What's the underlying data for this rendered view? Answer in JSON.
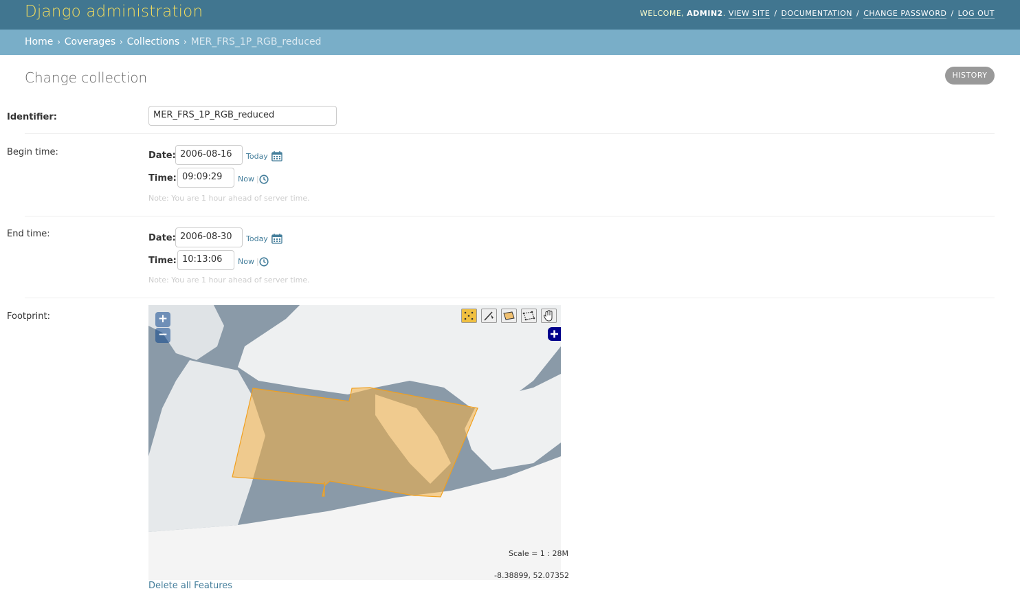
{
  "header": {
    "branding": "Django administration",
    "welcome": "WELCOME,",
    "username": "ADMIN2",
    "view_site": "VIEW SITE",
    "documentation": "DOCUMENTATION",
    "change_password": "CHANGE PASSWORD",
    "logout": "LOG OUT"
  },
  "breadcrumbs": {
    "home": "Home",
    "coverages": "Coverages",
    "collections": "Collections",
    "current": "MER_FRS_1P_RGB_reduced"
  },
  "page": {
    "title": "Change collection",
    "history_button": "HISTORY"
  },
  "form": {
    "identifier": {
      "label": "Identifier:",
      "value": "MER_FRS_1P_RGB_reduced"
    },
    "begin_time": {
      "label": "Begin time:",
      "date_label": "Date:",
      "date_value": "2006-08-16",
      "today": "Today",
      "time_label": "Time:",
      "time_value": "09:09:29",
      "now": "Now",
      "note": "Note: You are 1 hour ahead of server time."
    },
    "end_time": {
      "label": "End time:",
      "date_label": "Date:",
      "date_value": "2006-08-30",
      "today": "Today",
      "time_label": "Time:",
      "time_value": "10:13:06",
      "now": "Now",
      "note": "Note: You are 1 hour ahead of server time."
    },
    "footprint": {
      "label": "Footprint:",
      "zoom_in": "+",
      "zoom_out": "−",
      "scale": "Scale = 1 : 28M",
      "coordinates": "-8.38899, 52.07352",
      "delete_all": "Delete all Features"
    }
  },
  "colors": {
    "header_bg": "#417690",
    "breadcrumb_bg": "#79aec8",
    "branding": "#f5dd5d",
    "link": "#447e9b",
    "footprint_fill": "#f5b041"
  }
}
